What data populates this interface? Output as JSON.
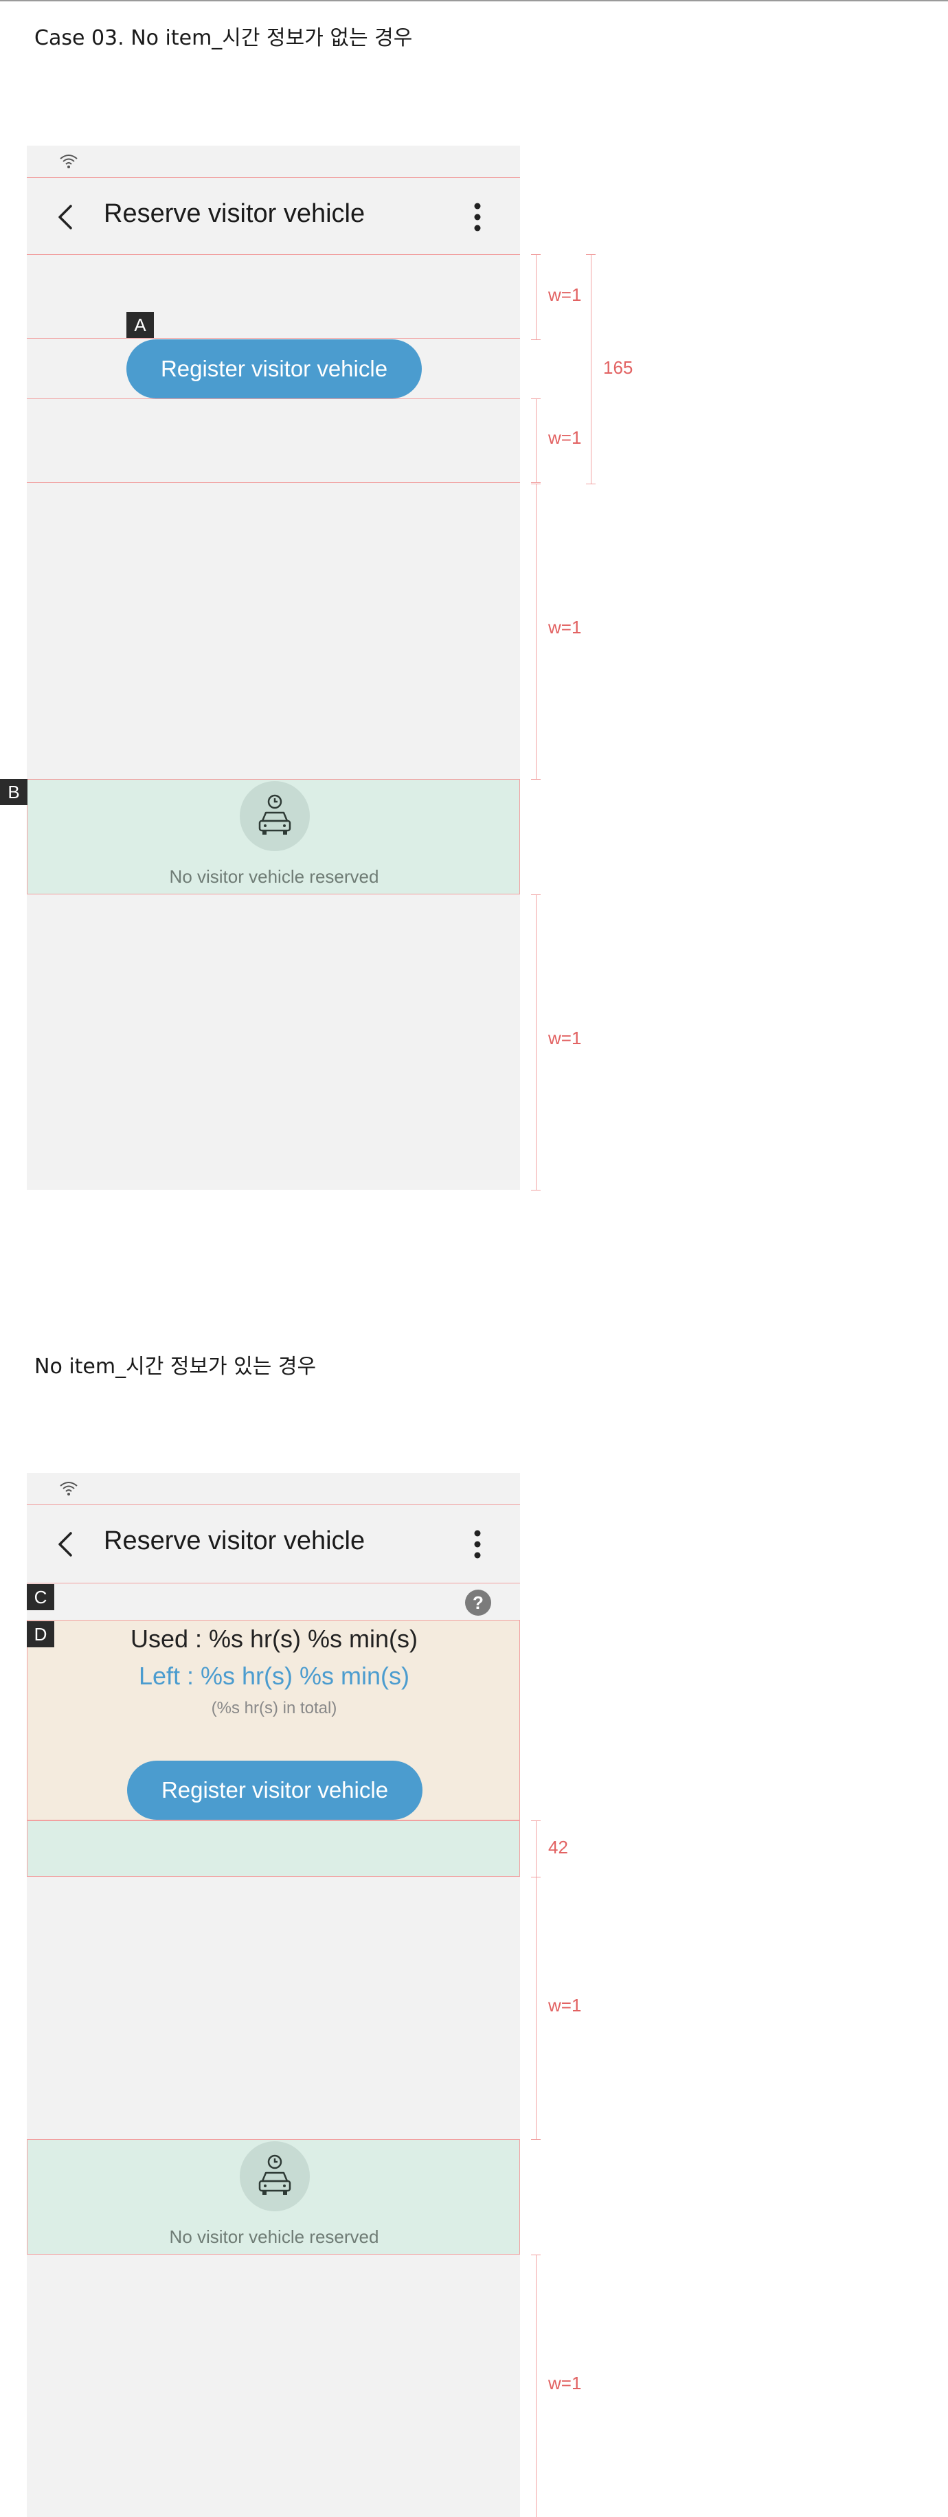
{
  "case1": {
    "section_title": "Case 03. No item_시간 정보가 없는 경우",
    "app_title": "Reserve visitor vehicle",
    "register_label": "Register visitor vehicle",
    "empty_text": "No visitor vehicle reserved",
    "tag_a": "A",
    "tag_b": "B",
    "dims": {
      "w1_a": "w=1",
      "w1_b": "w=1",
      "w1_c": "w=1",
      "w1_d": "w=1",
      "total": "165"
    }
  },
  "case2": {
    "section_title": "No item_시간 정보가 있는 경우",
    "app_title": "Reserve visitor vehicle",
    "tag_c": "C",
    "tag_d": "D",
    "help_glyph": "?",
    "used_text": "Used : %s hr(s) %s min(s)",
    "left_text": "Left : %s hr(s) %s min(s)",
    "total_text": "(%s hr(s) in total)",
    "register_label": "Register visitor vehicle",
    "empty_text": "No visitor vehicle reserved",
    "dims": {
      "h42": "42",
      "w1_a": "w=1",
      "w1_b": "w=1"
    }
  },
  "icons": [
    "wifi-icon",
    "back-arrow-icon",
    "more-vert-icon",
    "car-clock-icon",
    "help-icon"
  ],
  "colors": {
    "accent": "#4b9ccf",
    "guide": "#f1a0a0",
    "annotation_text": "#e26262",
    "green_fill": "#dceee6",
    "beige_fill": "#f4ebde",
    "screen_bg": "#f2f2f2"
  }
}
